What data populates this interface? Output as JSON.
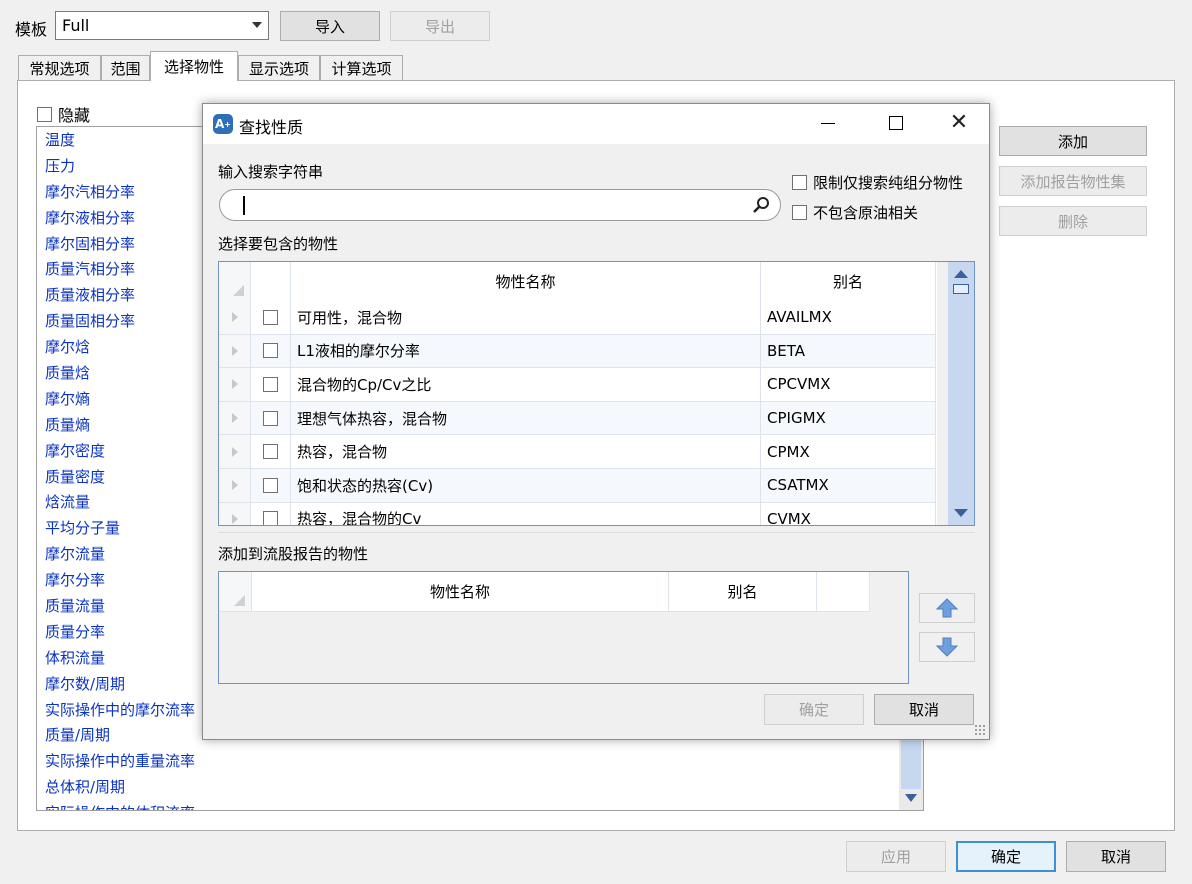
{
  "template": {
    "label": "模板",
    "value": "Full",
    "import_label": "导入",
    "export_label": "导出"
  },
  "tabs": [
    {
      "label": "常规选项"
    },
    {
      "label": "范围"
    },
    {
      "label": "选择物性"
    },
    {
      "label": "显示选项"
    },
    {
      "label": "计算选项"
    }
  ],
  "hide_label": "隐藏",
  "property_list": [
    "温度",
    "压力",
    "摩尔汽相分率",
    "摩尔液相分率",
    "摩尔固相分率",
    "质量汽相分率",
    "质量液相分率",
    "质量固相分率",
    "摩尔焓",
    "质量焓",
    "摩尔熵",
    "质量熵",
    "摩尔密度",
    "质量密度",
    "焓流量",
    "平均分子量",
    "摩尔流量",
    "摩尔分率",
    "质量流量",
    "质量分率",
    "体积流量",
    "摩尔数/周期",
    "实际操作中的摩尔流率",
    "质量/周期",
    "实际操作中的重量流率",
    "总体积/周期",
    "实际操作中的体积流率"
  ],
  "right_buttons": {
    "add": "添加",
    "add_set": "添加报告物性集",
    "delete": "删除"
  },
  "bottom_buttons": {
    "apply": "应用",
    "ok": "确定",
    "cancel": "取消"
  },
  "dialog": {
    "title": "查找性质",
    "search_label": "输入搜索字符串",
    "restrict_label": "限制仅搜索纯组分物性",
    "exclude_label": "不包含原油相关",
    "select_label": "选择要包含的物性",
    "col_name": "物性名称",
    "col_alias": "别名",
    "rows": [
      {
        "name": "可用性，混合物",
        "alias": "AVAILMX"
      },
      {
        "name": "L1液相的摩尔分率",
        "alias": "BETA"
      },
      {
        "name": "混合物的Cp/Cv之比",
        "alias": "CPCVMX"
      },
      {
        "name": "理想气体热容，混合物",
        "alias": "CPIGMX"
      },
      {
        "name": "热容，混合物",
        "alias": "CPMX"
      },
      {
        "name": "饱和状态的热容(Cv)",
        "alias": "CSATMX"
      },
      {
        "name": "热容，混合物的Cv",
        "alias": "CVMX"
      }
    ],
    "added_label": "添加到流股报告的物性",
    "added_col_name": "物性名称",
    "added_col_alias": "别名",
    "ok": "确定",
    "cancel": "取消"
  }
}
